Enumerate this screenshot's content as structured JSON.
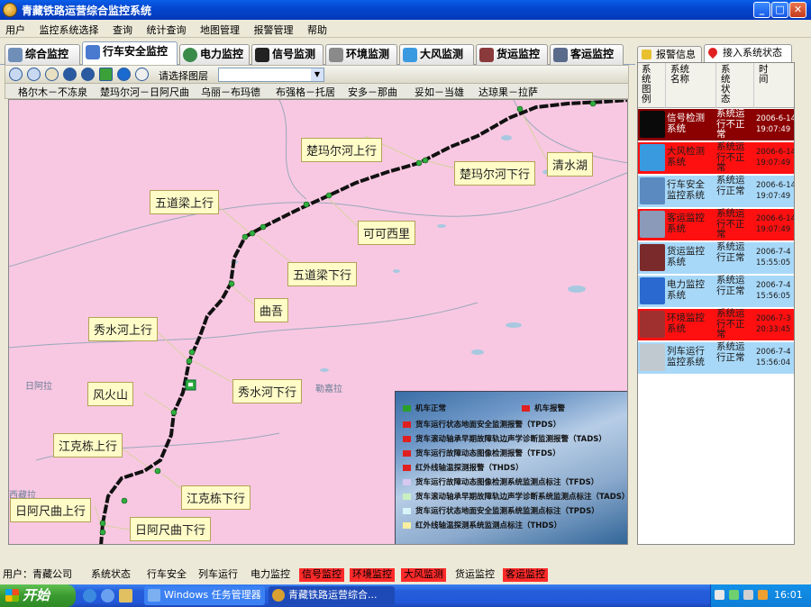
{
  "window": {
    "title": "青藏铁路运营综合监控系统",
    "btn_min": "_",
    "btn_max": "□",
    "btn_close": "✕"
  },
  "menu": [
    "用户",
    "监控系统选择",
    "查询",
    "统计查询",
    "地图管理",
    "报警管理",
    "帮助"
  ],
  "tabs": [
    {
      "label": "综合监控",
      "icon": "grid-icon",
      "active": false
    },
    {
      "label": "行车安全监控",
      "icon": "train-icon",
      "active": true
    },
    {
      "label": "电力监控",
      "icon": "globe-icon",
      "active": false
    },
    {
      "label": "信号监测",
      "icon": "signal-icon",
      "active": false
    },
    {
      "label": "环境监测",
      "icon": "environment-icon",
      "active": false
    },
    {
      "label": "大风监测",
      "icon": "wind-icon",
      "active": false
    },
    {
      "label": "货运监控",
      "icon": "freight-icon",
      "active": false
    },
    {
      "label": "客运监控",
      "icon": "passenger-icon",
      "active": false
    }
  ],
  "right_tabs": [
    {
      "label": "报警信息",
      "icon": "alarm-icon",
      "active": false
    },
    {
      "label": "接入系统状态",
      "icon": "pin-icon",
      "active": true
    }
  ],
  "toolbar": {
    "layer_label": "请选择图层",
    "layer_value": ""
  },
  "segments": [
    "格尔木－不冻泉",
    "楚玛尔河－日阿尺曲",
    "乌丽－布玛德",
    "布强格－托居",
    "安多－那曲",
    "妥如－当雄",
    "达琼果－拉萨"
  ],
  "map": {
    "places": [
      "日阿拉",
      "勒嘉拉",
      "西藏拉"
    ],
    "callouts": [
      "楚玛尔河上行",
      "楚玛尔河下行",
      "清水湖",
      "五道梁上行",
      "可可西里",
      "五道梁下行",
      "曲吾",
      "秀水河上行",
      "风火山",
      "秀水河下行",
      "江克栋上行",
      "江克栋下行",
      "日阿尺曲上行",
      "日阿尺曲下行"
    ]
  },
  "legend": [
    {
      "label": "机车正常",
      "color": "#2aa02a"
    },
    {
      "label": "机车报警",
      "color": "#e02020"
    },
    {
      "label": "货车运行状态地面安全监测报警（TPDS）",
      "color": "#e02020"
    },
    {
      "label": "货车滚动轴承早期故障轨边声学诊断监测报警（TADS）",
      "color": "#e02020"
    },
    {
      "label": "货车运行故障动态图像检测报警（TFDS）",
      "color": "#e02020"
    },
    {
      "label": "红外线轴温探测报警（THDS）",
      "color": "#e02020"
    },
    {
      "label": "货车运行故障动态图像检测系统监测点标注（TFDS）",
      "color": "#d8c8f0"
    },
    {
      "label": "货车滚动轴承早期故障轨边声学诊断系统监测点标注（TADS）",
      "color": "#c8f0c0"
    },
    {
      "label": "货车运行状态地面安全监测系统监测点标注（TPDS）",
      "color": "#d8f4f8"
    },
    {
      "label": "红外线轴温探测系统监测点标注（THDS）",
      "color": "#f8f0a0"
    }
  ],
  "status_panel": {
    "headers": [
      "系统图例",
      "系统名称",
      "系统状态",
      "时间"
    ],
    "rows": [
      {
        "name": "信号检测系统",
        "status": "系统运行不正常",
        "date": "2006-6-14",
        "time": "19:07:49",
        "bg": "#8b0000",
        "fg": "#ffffff",
        "icon": "signal-icon"
      },
      {
        "name": "大风检测系统",
        "status": "系统运行不正常",
        "date": "2006-6-14",
        "time": "19:07:49",
        "bg": "#ff1010",
        "fg": "#1a1a1a",
        "icon": "wind-icon"
      },
      {
        "name": "行车安全监控系统",
        "status": "系统运行正常",
        "date": "2006-6-14",
        "time": "19:07:49",
        "bg": "#a8d8f8",
        "fg": "#1a1a1a",
        "icon": "train-safety-icon"
      },
      {
        "name": "客运监控系统",
        "status": "系统运行不正常",
        "date": "2006-6-14",
        "time": "19:07:49",
        "bg": "#ff1010",
        "fg": "#1a1a1a",
        "icon": "passenger-icon"
      },
      {
        "name": "货运监控系统",
        "status": "系统运行正常",
        "date": "2006-7-4",
        "time": "15:55:05",
        "bg": "#a8d8f8",
        "fg": "#1a1a1a",
        "icon": "freight-icon"
      },
      {
        "name": "电力监控系统",
        "status": "系统运行正常",
        "date": "2006-7-4",
        "time": "15:56:05",
        "bg": "#a8d8f8",
        "fg": "#1a1a1a",
        "icon": "power-icon"
      },
      {
        "name": "环境监控系统",
        "status": "系统运行不正常",
        "date": "2006-7-3",
        "time": "20:33:45",
        "bg": "#ff1010",
        "fg": "#1a1a1a",
        "icon": "environment-icon"
      },
      {
        "name": "列车运行监控系统",
        "status": "系统运行正常",
        "date": "2006-7-4",
        "time": "15:56:04",
        "bg": "#a8d8f8",
        "fg": "#1a1a1a",
        "icon": "train-run-icon"
      }
    ]
  },
  "statusbar": {
    "user_label": "用户：",
    "user_value": "青藏公司",
    "items": [
      {
        "label": "系统状态",
        "alert": false
      },
      {
        "label": "行车安全",
        "alert": false
      },
      {
        "label": "列车运行",
        "alert": false
      },
      {
        "label": "电力监控",
        "alert": false
      },
      {
        "label": "信号监控",
        "alert": true
      },
      {
        "label": "环境监控",
        "alert": true
      },
      {
        "label": "大风监测",
        "alert": true
      },
      {
        "label": "货运监控",
        "alert": false
      },
      {
        "label": "客运监控",
        "alert": true
      }
    ]
  },
  "taskbar": {
    "start_label": "开始",
    "tasks": [
      "Windows 任务管理器",
      "青藏铁路运营综合..."
    ],
    "clock": "16:01"
  }
}
